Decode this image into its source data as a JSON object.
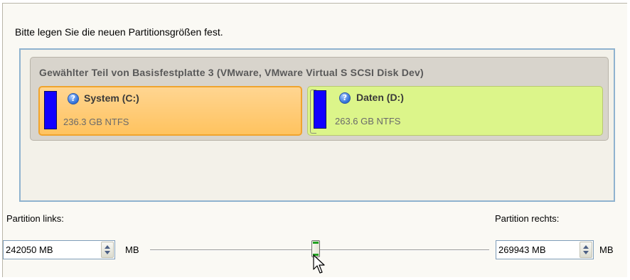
{
  "instruction": "Bitte legen Sie die neuen Partitionsgrößen fest.",
  "disk": {
    "title": "Gewählter Teil von Basisfestplatte 3 (VMware, VMware Virtual S SCSI Disk Dev)",
    "partitions": [
      {
        "name": "System (C:)",
        "info": "236.3 GB NTFS",
        "color": "#ffc35f",
        "selected": true
      },
      {
        "name": "Daten (D:)",
        "info": "263.6 GB NTFS",
        "color": "#dcf58a",
        "selected": false
      }
    ]
  },
  "left": {
    "label": "Partition links:",
    "value": "242050 MB",
    "unit": "MB"
  },
  "right": {
    "label": "Partition rechts:",
    "value": "269943 MB",
    "unit": "MB"
  },
  "slider": {
    "position_fraction": 0.49
  },
  "icons": {
    "help": "help-icon",
    "cursor": "arrow-cursor-icon"
  },
  "colors": {
    "partition_bar": "#1200ff",
    "panel_border": "#8fb3cf"
  }
}
